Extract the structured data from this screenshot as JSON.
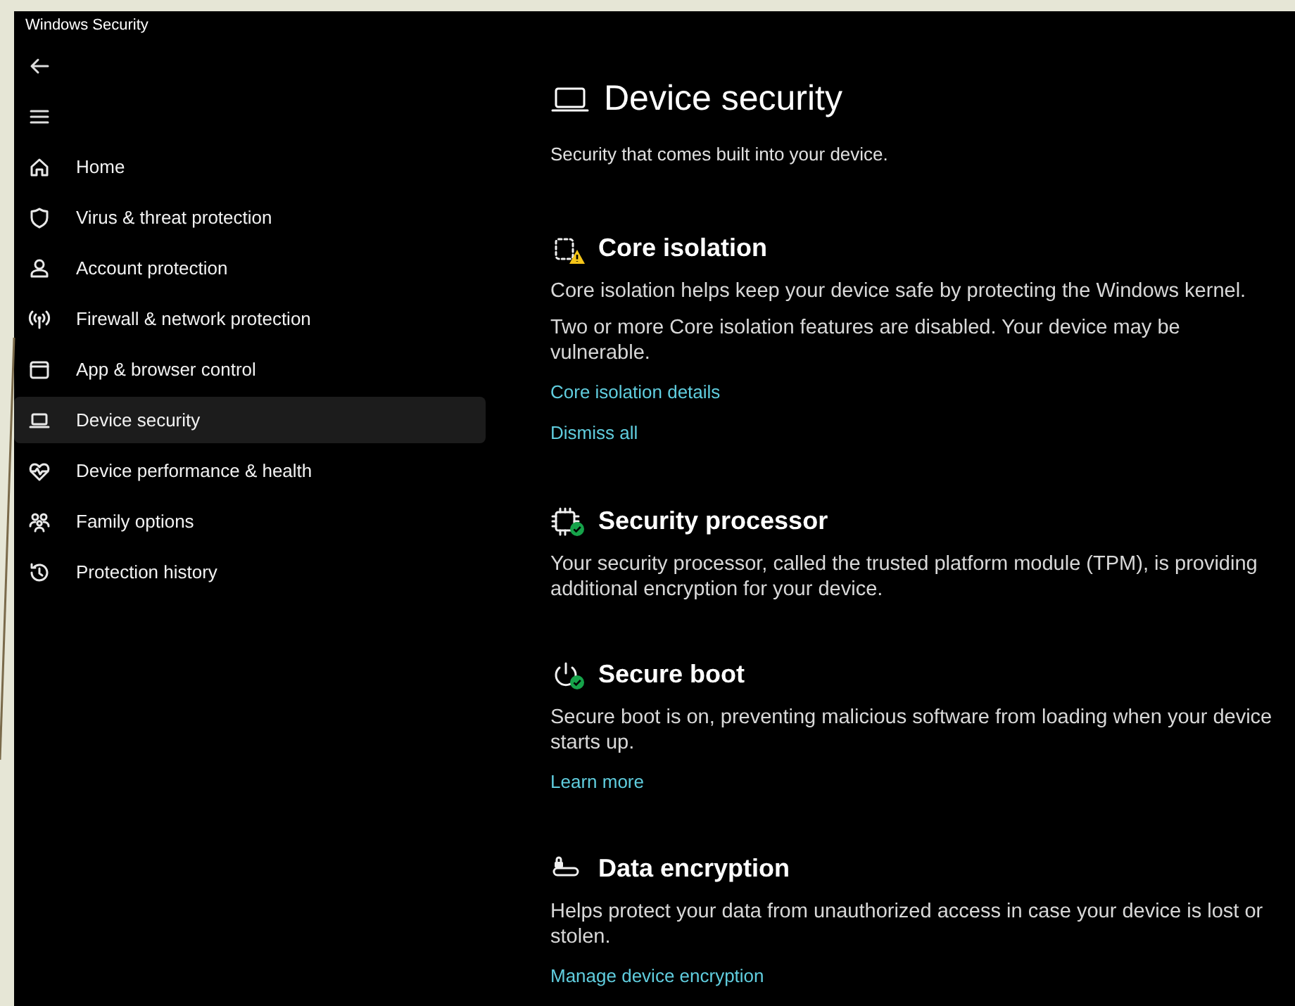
{
  "window": {
    "title": "Windows Security"
  },
  "sidebar": {
    "items": [
      {
        "label": "Home",
        "selected": false
      },
      {
        "label": "Virus & threat protection",
        "selected": false
      },
      {
        "label": "Account protection",
        "selected": false
      },
      {
        "label": "Firewall & network protection",
        "selected": false
      },
      {
        "label": "App & browser control",
        "selected": false
      },
      {
        "label": "Device security",
        "selected": true
      },
      {
        "label": "Device performance & health",
        "selected": false
      },
      {
        "label": "Family options",
        "selected": false
      },
      {
        "label": "Protection history",
        "selected": false
      }
    ]
  },
  "page": {
    "title": "Device security",
    "subtitle": "Security that comes built into your device."
  },
  "sections": [
    {
      "title": "Core isolation",
      "kind": "warning",
      "paragraphs": [
        "Core isolation helps keep your device safe by protecting the Windows kernel.",
        "Two or more Core isolation features are disabled.  Your device may be vulnerable."
      ],
      "links": [
        "Core isolation details",
        "Dismiss all"
      ]
    },
    {
      "title": "Security processor",
      "kind": "ok",
      "paragraphs": [
        "Your security processor, called the trusted platform module (TPM), is providing additional encryption for your device."
      ]
    },
    {
      "title": "Secure boot",
      "kind": "ok",
      "paragraphs": [
        "Secure boot is on, preventing malicious software from loading when your device starts up."
      ],
      "links": [
        "Learn more"
      ]
    },
    {
      "title": "Data encryption",
      "paragraphs": [
        "Helps protect your data from unauthorized access in case your device is lost or stolen."
      ],
      "links": [
        "Manage device encryption"
      ]
    }
  ]
}
